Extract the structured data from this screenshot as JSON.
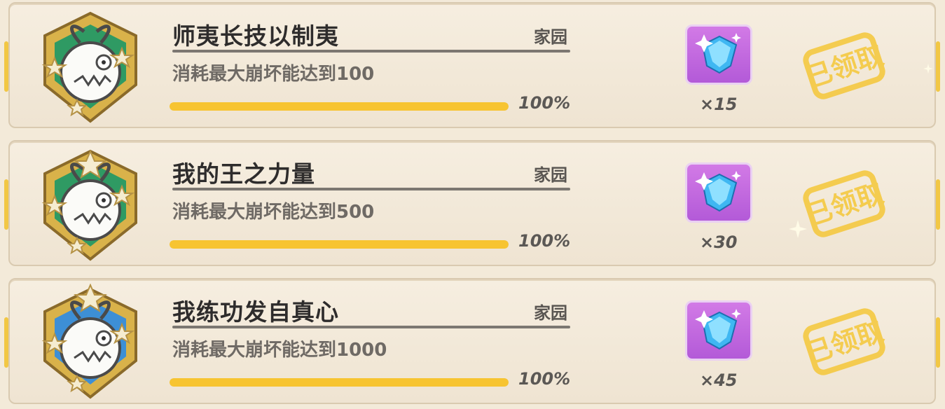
{
  "achievements": [
    {
      "title": "师夷长技以制夷",
      "category": "家园",
      "description": "消耗最大崩坏能达到100",
      "progress_percent": 100,
      "progress_label": "100%",
      "reward_icon": "crystal-gem-icon",
      "reward_quantity": "×15",
      "status": "已领取",
      "badge_style": "green"
    },
    {
      "title": "我的王之力量",
      "category": "家园",
      "description": "消耗最大崩坏能达到500",
      "progress_percent": 100,
      "progress_label": "100%",
      "reward_icon": "crystal-gem-icon",
      "reward_quantity": "×30",
      "status": "已领取",
      "badge_style": "green"
    },
    {
      "title": "我练功发自真心",
      "category": "家园",
      "description": "消耗最大崩坏能达到1000",
      "progress_percent": 100,
      "progress_label": "100%",
      "reward_icon": "crystal-gem-icon",
      "reward_quantity": "×45",
      "status": "已领取",
      "badge_style": "blue"
    }
  ],
  "colors": {
    "card_bg": "#f3ead9",
    "progress_fill": "#f7c431",
    "stamp_yellow": "#f5c738",
    "reward_bg": "#c46ae0",
    "gem_blue": "#3fb7f2",
    "badge_gold": "#d9b24a",
    "badge_green": "#2f9a63",
    "badge_blue": "#3d8fd6"
  }
}
